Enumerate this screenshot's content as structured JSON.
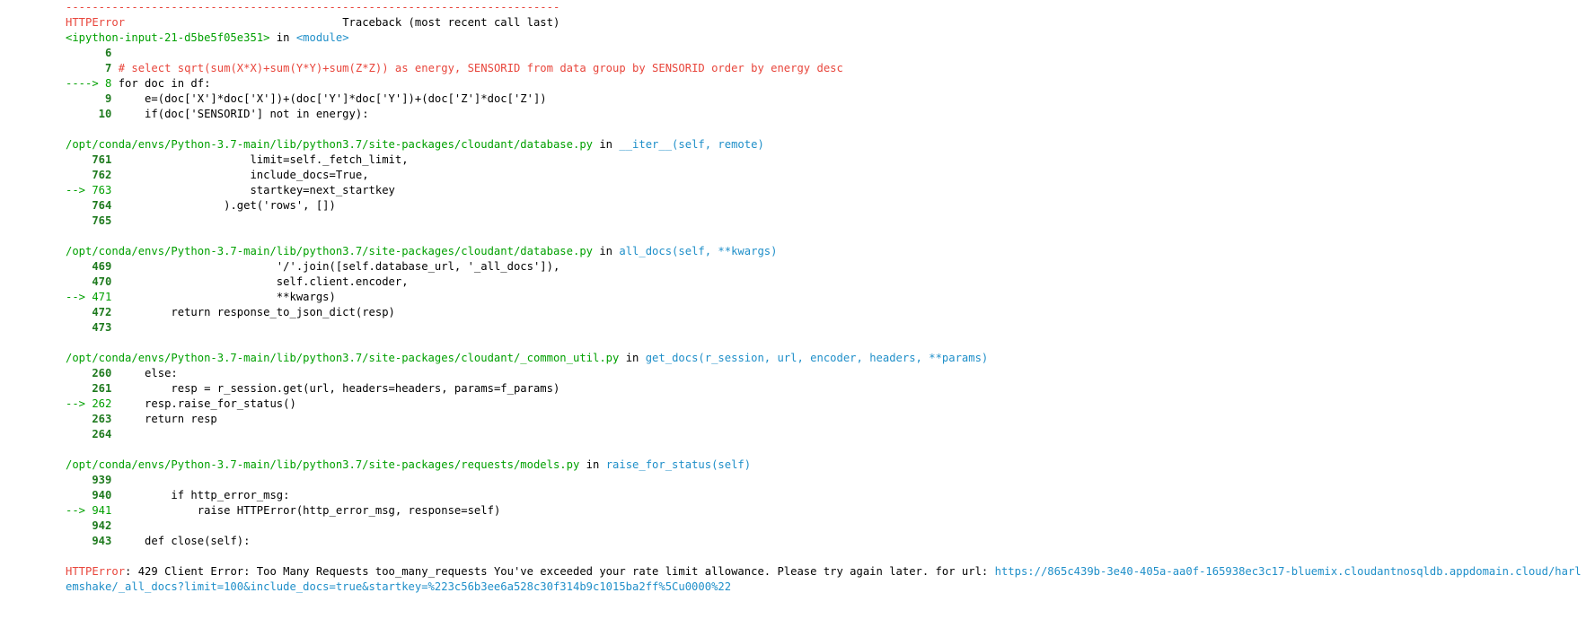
{
  "traceback": {
    "separator": "---------------------------------------------------------------------------",
    "error_type": "HTTPError",
    "header_gap": "                                 ",
    "header_title": "Traceback (most recent call last)",
    "frames": [
      {
        "location": "<ipython-input-21-d5be5f05e351>",
        "in_word": " in ",
        "func": "<module>",
        "lines": [
          {
            "num": "      6",
            "code": ""
          },
          {
            "num": "      7",
            "code": " # select sqrt(sum(X*X)+sum(Y*Y)+sum(Z*Z)) as energy, SENSORID from data group by SENSORID order by energy desc",
            "comment": true
          },
          {
            "num": "----> 8",
            "code": " for doc in df:",
            "arrow": true
          },
          {
            "num": "      9",
            "code": "     e=(doc['X']*doc['X'])+(doc['Y']*doc['Y'])+(doc['Z']*doc['Z'])"
          },
          {
            "num": "     10",
            "code": "     if(doc['SENSORID'] not in energy):"
          }
        ]
      },
      {
        "location": "/opt/conda/envs/Python-3.7-main/lib/python3.7/site-packages/cloudant/database.py",
        "in_word": " in ",
        "func": "__iter__(self, remote)",
        "lines": [
          {
            "num": "    761",
            "code": "                     limit=self._fetch_limit,"
          },
          {
            "num": "    762",
            "code": "                     include_docs=True,"
          },
          {
            "num": "--> 763",
            "code": "                     startkey=next_startkey",
            "arrow": true
          },
          {
            "num": "    764",
            "code": "                 ).get('rows', [])"
          },
          {
            "num": "    765",
            "code": ""
          }
        ]
      },
      {
        "location": "/opt/conda/envs/Python-3.7-main/lib/python3.7/site-packages/cloudant/database.py",
        "in_word": " in ",
        "func": "all_docs(self, **kwargs)",
        "lines": [
          {
            "num": "    469",
            "code": "                         '/'.join([self.database_url, '_all_docs']),"
          },
          {
            "num": "    470",
            "code": "                         self.client.encoder,"
          },
          {
            "num": "--> 471",
            "code": "                         **kwargs)",
            "arrow": true
          },
          {
            "num": "    472",
            "code": "         return response_to_json_dict(resp)"
          },
          {
            "num": "    473",
            "code": ""
          }
        ]
      },
      {
        "location": "/opt/conda/envs/Python-3.7-main/lib/python3.7/site-packages/cloudant/_common_util.py",
        "in_word": " in ",
        "func": "get_docs(r_session, url, encoder, headers, **params)",
        "lines": [
          {
            "num": "    260",
            "code": "     else:"
          },
          {
            "num": "    261",
            "code": "         resp = r_session.get(url, headers=headers, params=f_params)"
          },
          {
            "num": "--> 262",
            "code": "     resp.raise_for_status()",
            "arrow": true
          },
          {
            "num": "    263",
            "code": "     return resp"
          },
          {
            "num": "    264",
            "code": ""
          }
        ]
      },
      {
        "location": "/opt/conda/envs/Python-3.7-main/lib/python3.7/site-packages/requests/models.py",
        "in_word": " in ",
        "func": "raise_for_status(self)",
        "lines": [
          {
            "num": "    939",
            "code": ""
          },
          {
            "num": "    940",
            "code": "         if http_error_msg:"
          },
          {
            "num": "--> 941",
            "code": "             raise HTTPError(http_error_msg, response=self)",
            "arrow": true
          },
          {
            "num": "    942",
            "code": ""
          },
          {
            "num": "    943",
            "code": "     def close(self):"
          }
        ]
      }
    ],
    "final_error": {
      "type": "HTTPError",
      "message": ": 429 Client Error: Too Many Requests too_many_requests You've exceeded your rate limit allowance. Please try again later. for url: ",
      "url": "https://865c439b-3e40-405a-aa0f-165938ec3c17-bluemix.cloudantnosqldb.appdomain.cloud/harlemshake/_all_docs?limit=100&include_docs=true&startkey=%223c56b3ee6a528c30f314b9c1015ba2ff%5Cu0000%22"
    },
    "colors": {
      "error_red": "#e8463c",
      "path_green": "#00a000",
      "func_blue": "#1f8fc9",
      "lineno_green": "#1e7a1e"
    }
  }
}
